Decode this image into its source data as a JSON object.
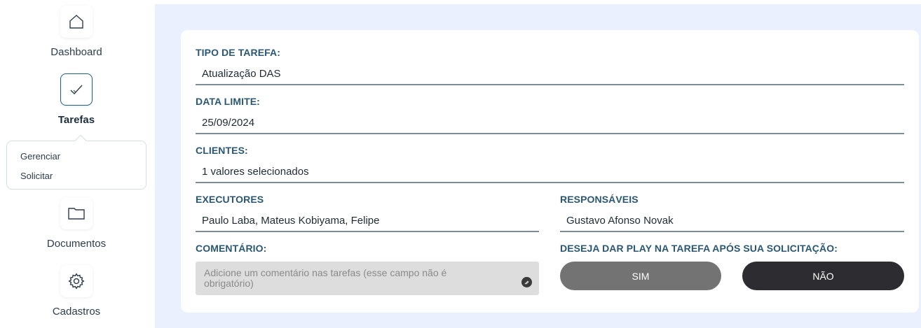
{
  "sidebar": {
    "items": [
      {
        "label": "Dashboard",
        "icon": "home-icon"
      },
      {
        "label": "Tarefas",
        "icon": "check-icon",
        "active": true
      },
      {
        "label": "Documentos",
        "icon": "folder-icon"
      },
      {
        "label": "Cadastros",
        "icon": "gear-icon"
      }
    ],
    "submenu": [
      "Gerenciar",
      "Solicitar"
    ]
  },
  "form": {
    "tipo_label": "TIPO DE TAREFA:",
    "tipo_value": "Atualização DAS",
    "data_label": "DATA LIMITE:",
    "data_value": "25/09/2024",
    "clientes_label": "CLIENTES:",
    "clientes_value": "1 valores selecionados",
    "executores_label": "EXECUTORES",
    "executores_value": "Paulo Laba, Mateus Kobiyama, Felipe",
    "responsaveis_label": "RESPONSÁVEIS",
    "responsaveis_value": "Gustavo Afonso Novak",
    "comentario_label": "COMENTÁRIO:",
    "comentario_placeholder": "Adicione um comentário nas tarefas (esse campo não é obrigatório)",
    "play_label": "DESEJA DAR PLAY NA TAREFA APÓS SUA SOLICITAÇÃO:",
    "sim_label": "SIM",
    "nao_label": "NÃO"
  },
  "colors": {
    "accent": "#2a5773",
    "main_bg": "#eaf0fd",
    "sim_button": "#737373",
    "nao_button": "#2d2d31"
  }
}
